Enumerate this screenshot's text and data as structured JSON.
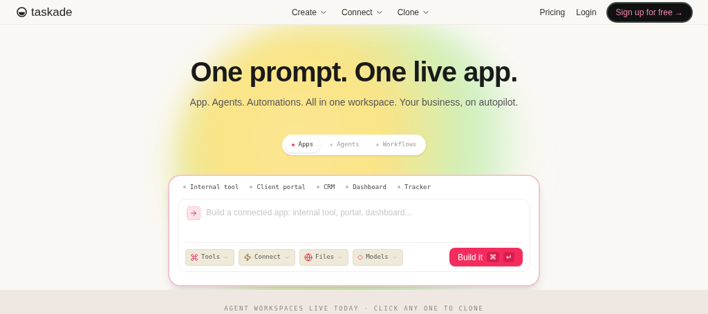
{
  "brand": "taskade",
  "nav": [
    {
      "label": "Create"
    },
    {
      "label": "Connect"
    },
    {
      "label": "Clone"
    }
  ],
  "nav_right": {
    "links": [
      "Pricing",
      "Login"
    ],
    "cta": "Sign up for free →"
  },
  "hero": {
    "title": "One prompt. One live app.",
    "subtitle": "App. Agents. Automations. All in one workspace. Your business, on autopilot."
  },
  "mode_tabs": [
    {
      "label": "Apps",
      "selected": true
    },
    {
      "label": "Agents",
      "selected": false
    },
    {
      "label": "Workflows",
      "selected": false
    }
  ],
  "suggestions": [
    "Internal tool",
    "Client portal",
    "CRM",
    "Dashboard",
    "Tracker"
  ],
  "prompt": {
    "placeholder": "Build a connected app: internal tool, portal, dashboard..."
  },
  "tool_buttons": [
    {
      "kind": "tools",
      "label": "Tools"
    },
    {
      "kind": "connect",
      "label": "Connect"
    },
    {
      "kind": "files",
      "label": "Files"
    },
    {
      "kind": "models",
      "label": "Models"
    }
  ],
  "build_button": {
    "label": "Build it",
    "keys": [
      "⌘",
      "↵"
    ]
  },
  "section_caption": "AGENT WORKSPACES LIVE TODAY · CLICK ANY ONE TO CLONE"
}
